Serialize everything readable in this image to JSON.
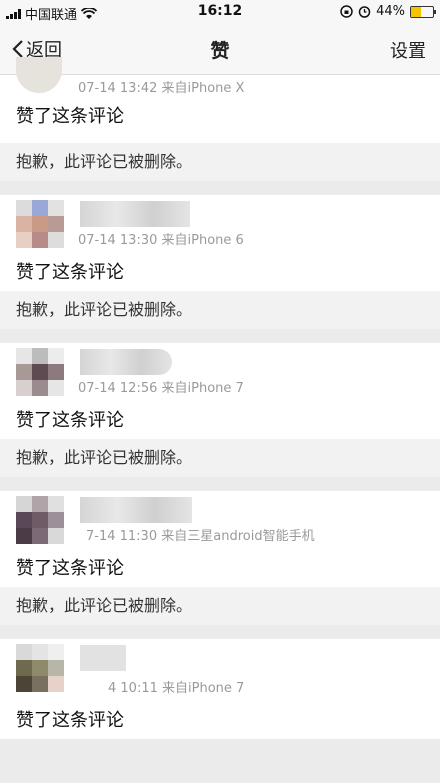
{
  "status": {
    "carrier": "中国联通",
    "time": "16:12",
    "battery": "44%",
    "battery_level": 0.44,
    "icons": [
      "signal-icon",
      "wifi-icon",
      "lock-rotation-icon",
      "alarm-icon",
      "battery-icon"
    ]
  },
  "nav": {
    "back_label": "返回",
    "title": "赞",
    "settings_label": "设置"
  },
  "items": [
    {
      "meta": "07-14 13:42  来自iPhone X",
      "action": "赞了这条评论",
      "quote": "抱歉，此评论已被删除。"
    },
    {
      "meta": "07-14 13:30  来自iPhone 6",
      "action": "赞了这条评论",
      "quote": "抱歉，此评论已被删除。"
    },
    {
      "meta": "07-14 12:56  来自iPhone 7",
      "action": "赞了这条评论",
      "quote": "抱歉，此评论已被删除。"
    },
    {
      "meta": "7-14 11:30  来自三星android智能手机",
      "action": "赞了这条评论",
      "quote": "抱歉，此评论已被删除。"
    },
    {
      "meta": "4 10:11  来自iPhone 7",
      "action": "赞了这条评论",
      "quote": ""
    }
  ],
  "colors": {
    "accent": "#f5c400",
    "meta_text": "#9a9a9a",
    "quote_bg": "#f2f2f2",
    "page_bg": "#ebebeb"
  }
}
